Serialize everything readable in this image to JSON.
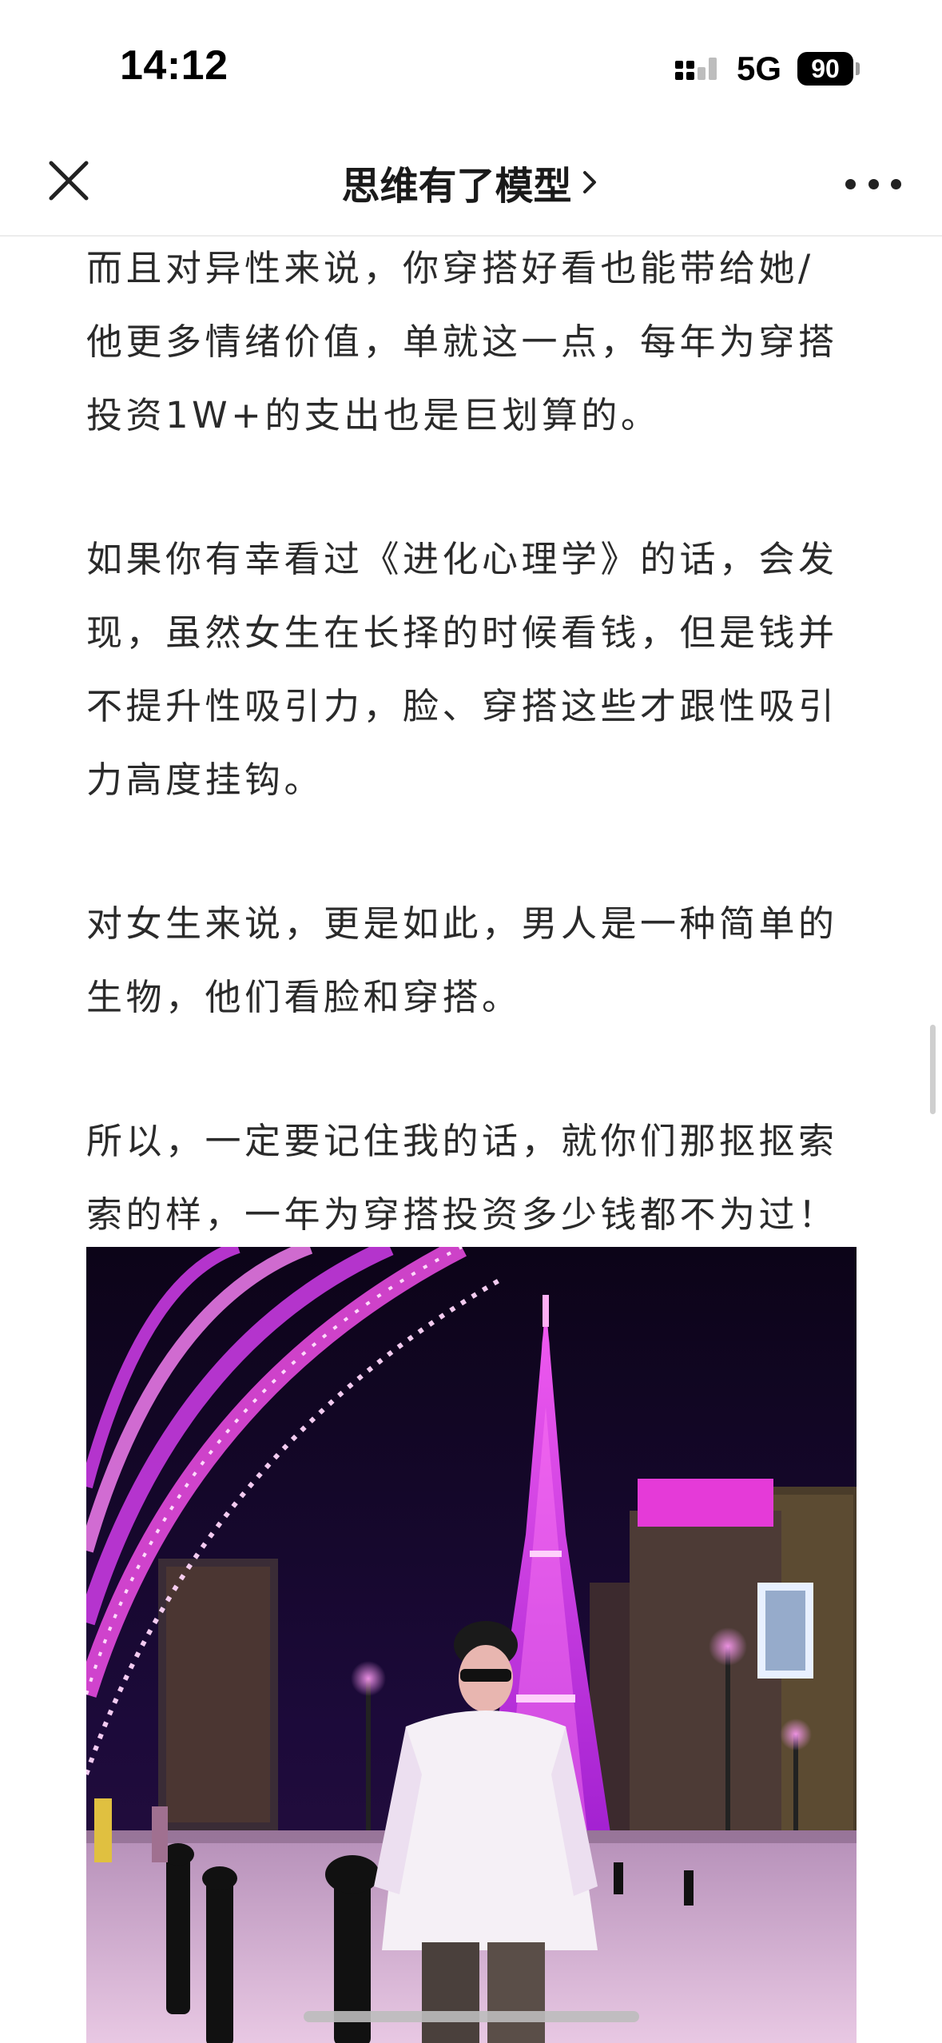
{
  "status_bar": {
    "time": "14:12",
    "network": "5G",
    "battery": "90"
  },
  "nav": {
    "title": "思维有了模型",
    "close_icon": "close-icon",
    "more_icon": "more-horizontal-icon",
    "chevron_icon": "chevron-right-icon"
  },
  "article": {
    "paragraphs": [
      "而且对异性来说，你穿搭好看也能带给她/他更多情绪价值，单就这一点，每年为穿搭投资1W+的支出也是巨划算的。",
      "如果你有幸看过《进化心理学》的话，会发现，虽然女生在长择的时候看钱，但是钱并不提升性吸引力，脸、穿搭这些才跟性吸引力高度挂钩。",
      "对女生来说，更是如此，男人是一种简单的生物，他们看脸和穿搭。",
      "所以，一定要记住我的话，就你们那抠抠索索的样，一年为穿搭投资多少钱都不为过！"
    ],
    "lines": [
      [
        "而且对异性来说，你穿搭好看也能带给她/",
        "他更多情绪价值，单就这一点，每年为穿搭",
        "投资1W+的支出也是巨划算的。"
      ],
      [
        "如果你有幸看过《进化心理学》的话，会发",
        "现，虽然女生在长择的时候看钱，但是钱并",
        "不提升性吸引力，脸、穿搭这些才跟性吸引",
        "力高度挂钩。"
      ],
      [
        "对女生来说，更是如此，男人是一种简单的",
        "生物，他们看脸和穿搭。"
      ],
      [
        "所以，一定要记住我的话，就你们那抠抠索",
        "索的样，一年为穿搭投资多少钱都不为过！"
      ]
    ]
  },
  "colors": {
    "text": "#2a2a2a",
    "sky": "#120626",
    "neon_pink": "#e02bd8",
    "neon_purple": "#b41ee6"
  }
}
